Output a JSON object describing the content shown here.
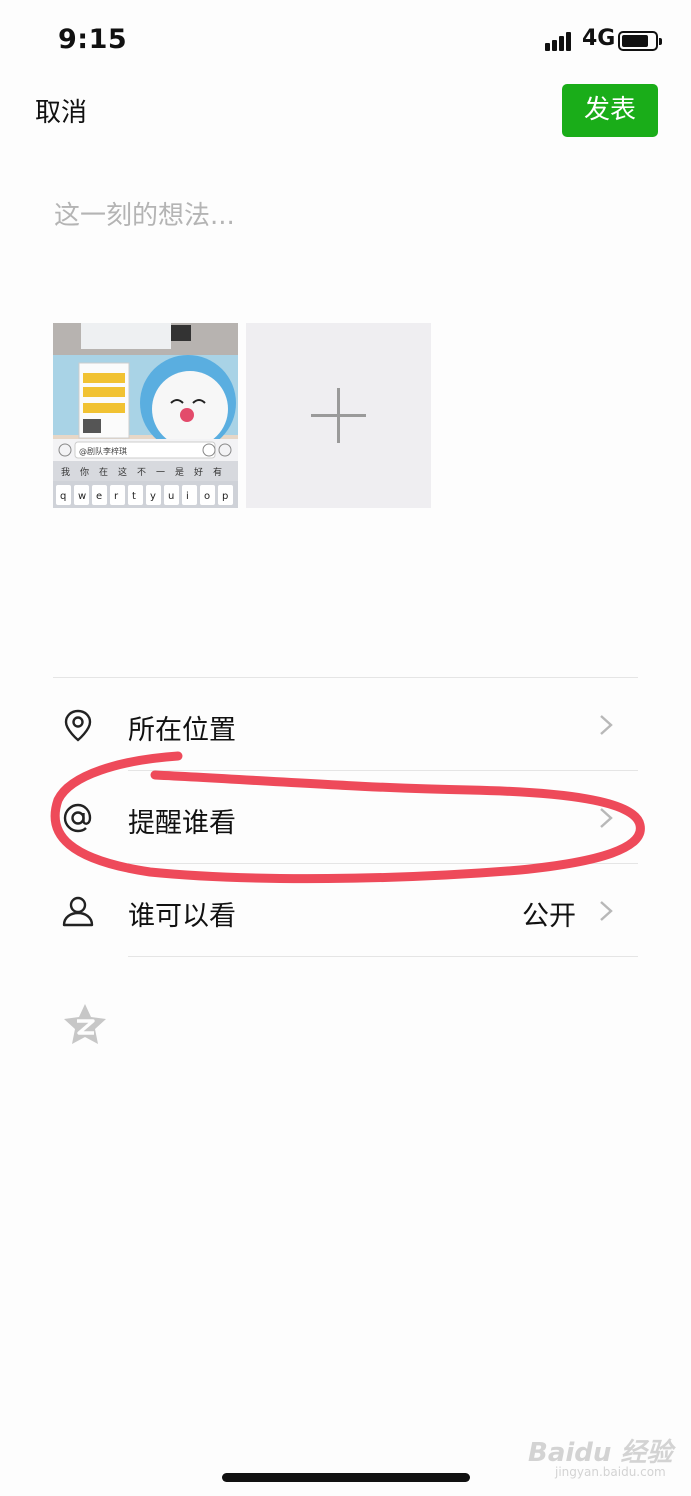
{
  "status_bar": {
    "time": "9:15",
    "network": "4G"
  },
  "nav": {
    "cancel_label": "取消",
    "publish_label": "发表"
  },
  "compose": {
    "placeholder": "这一刻的想法..."
  },
  "photos": {
    "thumbnail": {
      "input_text": "@剧队李梓琪",
      "keyboard_suggestions": [
        "我",
        "你",
        "在",
        "这",
        "不",
        "一",
        "是",
        "好",
        "有"
      ],
      "keyboard_keys": [
        "q",
        "w",
        "e",
        "r",
        "t",
        "y",
        "u",
        "i",
        "o",
        "p"
      ]
    },
    "add_icon": "plus-icon"
  },
  "options": [
    {
      "icon": "location-pin-icon",
      "label": "所在位置",
      "value": ""
    },
    {
      "icon": "at-sign-icon",
      "label": "提醒谁看",
      "value": ""
    },
    {
      "icon": "person-icon",
      "label": "谁可以看",
      "value": "公开"
    }
  ],
  "qzone_icon": "qzone-star-icon",
  "colors": {
    "accent": "#1aad19",
    "annotation": "#ee4a5a",
    "placeholder": "#b4b4b4"
  },
  "watermark": {
    "brand": "Baidu 经验",
    "url": "jingyan.baidu.com"
  }
}
